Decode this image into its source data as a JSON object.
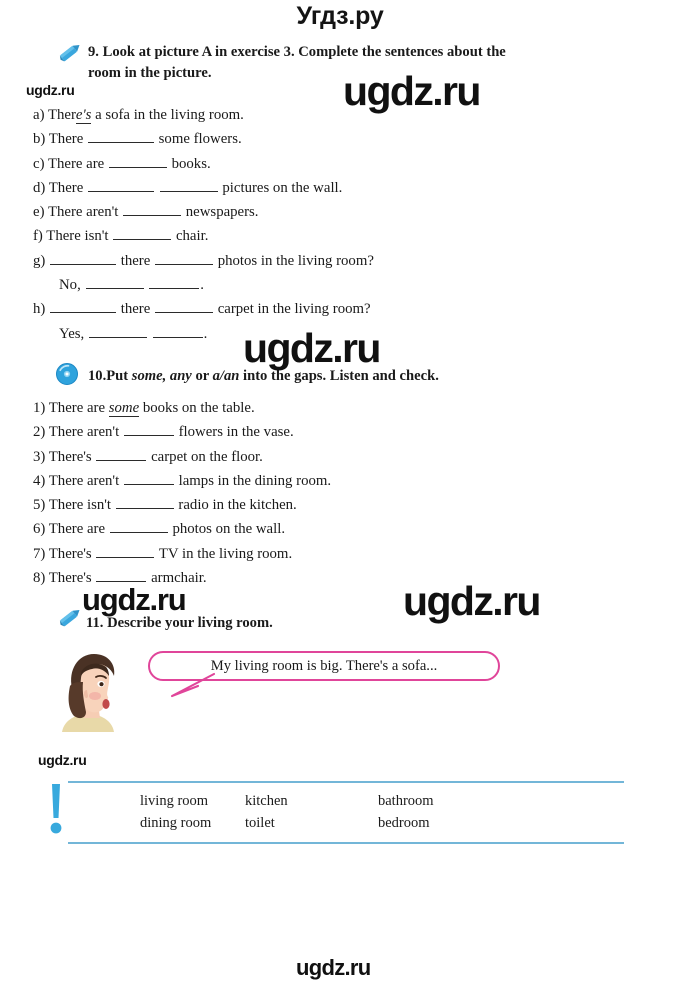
{
  "site": {
    "header_title": "Угдз.ру",
    "watermark_text": "ugdz.ru"
  },
  "exercise9": {
    "icon": "pencil-icon",
    "number": "9.",
    "heading_line1": "Look at picture A in exercise 3. Complete the sentences about the",
    "heading_line2": "room in the picture.",
    "items": [
      {
        "label": "a)",
        "text_before": "Ther",
        "answer": "e's",
        "text_after": "a sofa in the living room."
      },
      {
        "label": "b)",
        "text_before": "There",
        "text_after": "some flowers."
      },
      {
        "label": "c)",
        "text_before": "There are",
        "text_after": "books."
      },
      {
        "label": "d)",
        "text_before": "There",
        "text_after": "pictures on the wall."
      },
      {
        "label": "e)",
        "text_before": "There aren't",
        "text_after": "newspapers."
      },
      {
        "label": "f)",
        "text_before": "There isn't",
        "text_after": "chair."
      },
      {
        "label": "g)",
        "text_before": "",
        "text_middle": "there",
        "text_after": "photos in the living room?",
        "sub": "No,"
      },
      {
        "label": "h)",
        "text_before": "",
        "text_middle": "there",
        "text_after": "carpet in the living room?",
        "sub": "Yes,"
      }
    ]
  },
  "exercise10": {
    "icon": "cd-icon",
    "number": "10.",
    "heading_part1": "Put ",
    "heading_italic1": "some, any",
    "heading_part2": " or ",
    "heading_italic2": "a/an",
    "heading_part3": " into the gaps. Listen and check.",
    "items": [
      {
        "label": "1)",
        "text_before": "There are",
        "answer": "some",
        "text_after": "books on the table."
      },
      {
        "label": "2)",
        "text_before": "There aren't",
        "text_after": "flowers in the vase."
      },
      {
        "label": "3)",
        "text_before": "There's",
        "text_after": "carpet on the floor."
      },
      {
        "label": "4)",
        "text_before": "There aren't",
        "text_after": "lamps in the dining room."
      },
      {
        "label": "5)",
        "text_before": "There isn't",
        "text_after": "radio in the kitchen."
      },
      {
        "label": "6)",
        "text_before": "There are",
        "text_after": "photos on the wall."
      },
      {
        "label": "7)",
        "text_before": "There's",
        "text_after": "TV in the living room."
      },
      {
        "label": "8)",
        "text_before": "There's",
        "text_after": "armchair."
      }
    ]
  },
  "exercise11": {
    "icon": "pencil-icon",
    "number": "11.",
    "heading": "Describe your living room.",
    "bubble_text": "My living room is big. There's a sofa...",
    "bubble_border_color": "#e0459a",
    "avatar": "girl-profile-illustration"
  },
  "vocabulary": {
    "icon": "exclamation-icon",
    "icon_color": "#38a9dd",
    "rule_color": "#73b6d8",
    "row1": [
      "living room",
      "kitchen",
      "bathroom"
    ],
    "row2": [
      "dining room",
      "toilet",
      "bedroom"
    ]
  }
}
